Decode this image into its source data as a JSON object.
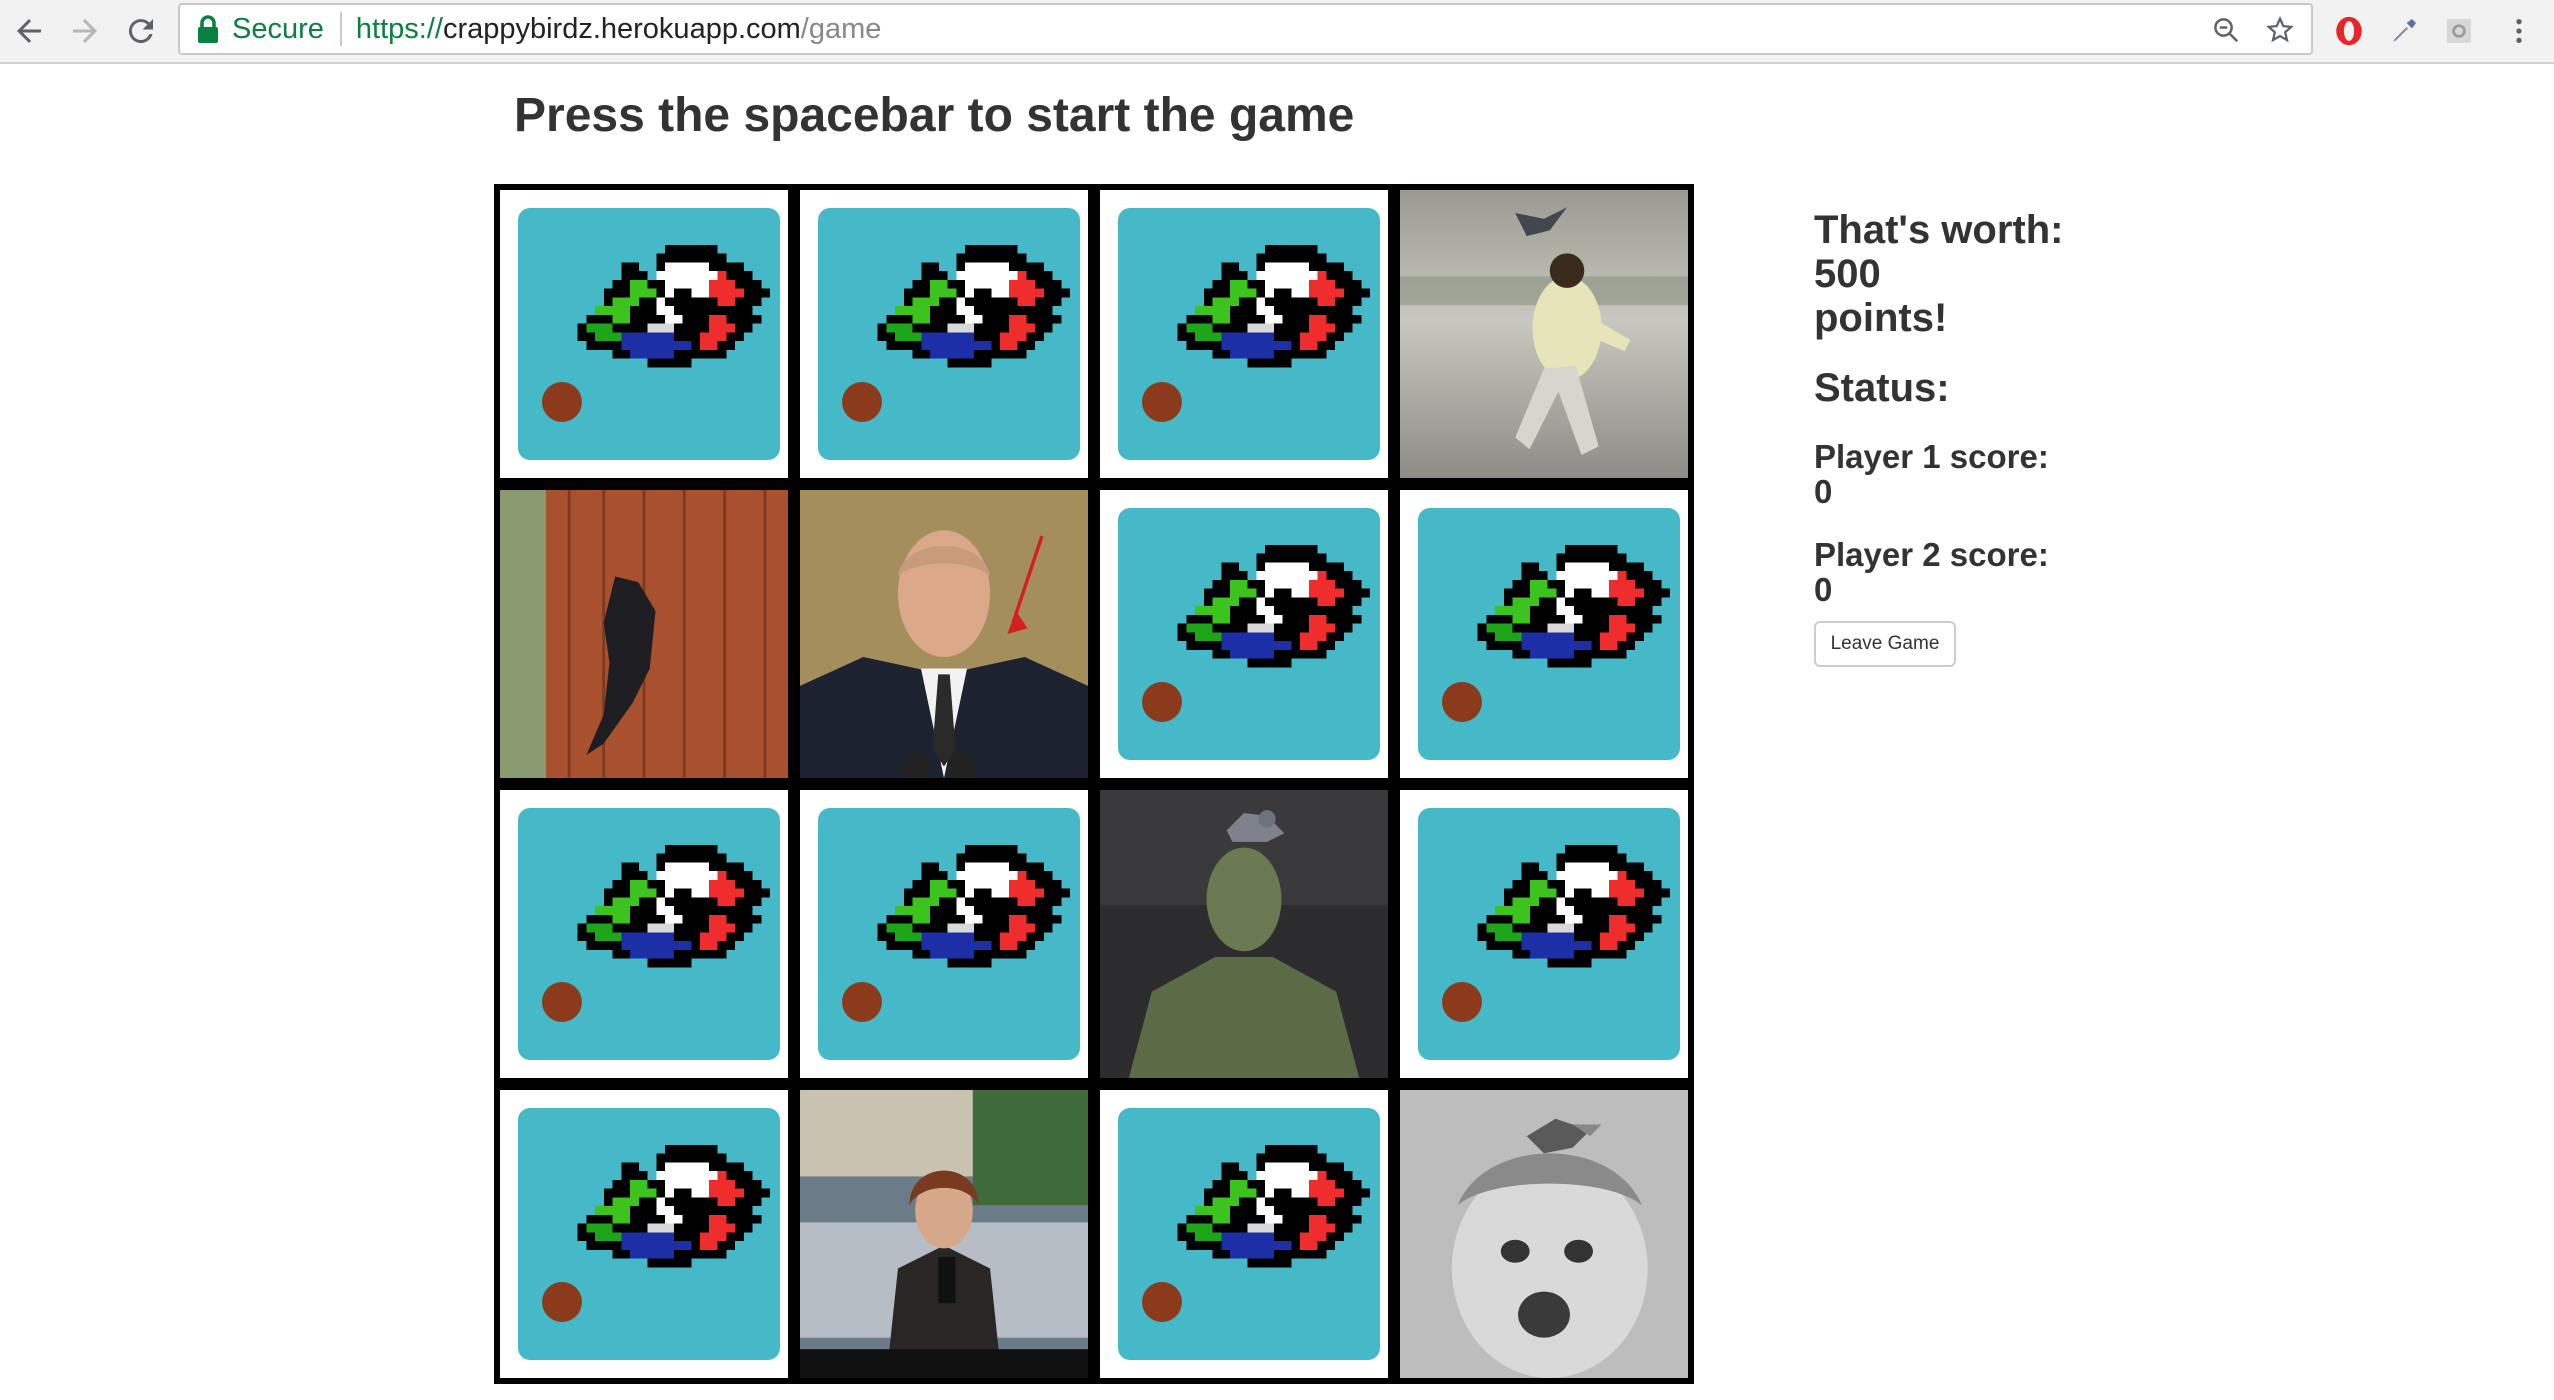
{
  "browser": {
    "secure_label": "Secure",
    "url_scheme": "https://",
    "url_host": "crappybirdz.herokuapp.com",
    "url_path": "/game",
    "icons": [
      "back-icon",
      "forward-icon",
      "reload-icon",
      "lock-icon",
      "zoom-icon",
      "bookmark-star-icon",
      "opera-extension-icon",
      "eyedropper-extension-icon",
      "extension-icon",
      "menu-icon"
    ]
  },
  "game": {
    "headline": "Press the spacebar to start the game",
    "card_back_color": "#45b9c8",
    "board": [
      [
        "hidden",
        "hidden",
        "hidden",
        "photo-child-pigeon"
      ],
      [
        "photo-crow-fence",
        "photo-man-suit",
        "hidden",
        "hidden"
      ],
      [
        "hidden",
        "hidden",
        "photo-statue-pigeon",
        "hidden"
      ],
      [
        "hidden",
        "photo-news-reporter",
        "hidden",
        "photo-child-parakeet"
      ]
    ]
  },
  "sidebar": {
    "worth_prefix": "That's worth:",
    "worth_points": "500",
    "worth_suffix": "points!",
    "status_label": "Status:",
    "player1_label": "Player 1 score:",
    "player1_score": "0",
    "player2_label": "Player 2 score:",
    "player2_score": "0",
    "leave_button": "Leave Game"
  }
}
